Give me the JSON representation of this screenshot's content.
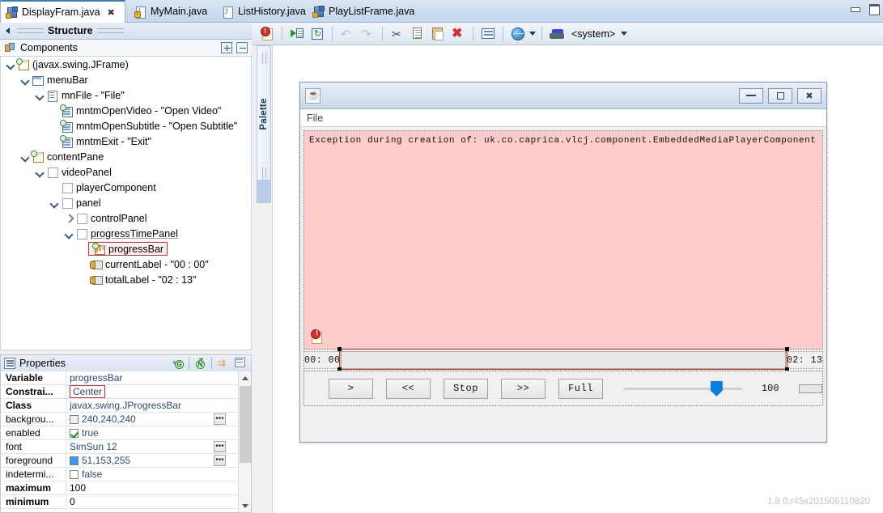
{
  "window": {
    "minimize_label": "minimize",
    "restore_label": "restore"
  },
  "tabs": [
    {
      "label": "DisplayFram.java",
      "icon": "java-class-icon",
      "active": true,
      "close": "✖"
    },
    {
      "label": "MyMain.java",
      "icon": "java-file-icon",
      "active": false
    },
    {
      "label": "ListHistory.java",
      "icon": "java-file-icon",
      "active": false
    },
    {
      "label": "PlayListFrame.java",
      "icon": "java-class-icon",
      "active": false
    }
  ],
  "structure": {
    "title": "Structure"
  },
  "components": {
    "title": "Components",
    "expand_all_label": "+",
    "collapse_all_label": "−",
    "tree": [
      {
        "label": "(javax.swing.JFrame)",
        "indent": 0,
        "twisty": "down",
        "icon": "frame-icon",
        "badge": true
      },
      {
        "label": "menuBar",
        "indent": 1,
        "twisty": "down",
        "icon": "menubar-icon",
        "badge": false
      },
      {
        "label": "mnFile - \"File\"",
        "indent": 2,
        "twisty": "down",
        "icon": "menu-icon",
        "badge": false
      },
      {
        "label": "mntmOpenVideo - \"Open Video\"",
        "indent": 3,
        "twisty": "none",
        "icon": "menuitem-icon",
        "badge": true
      },
      {
        "label": "mntmOpenSubtitle - \"Open Subtitle\"",
        "indent": 3,
        "twisty": "none",
        "icon": "menuitem-icon",
        "badge": true
      },
      {
        "label": "mntmExit - \"Exit\"",
        "indent": 3,
        "twisty": "none",
        "icon": "menuitem-icon",
        "badge": true
      },
      {
        "label": "contentPane",
        "indent": 1,
        "twisty": "down",
        "icon": "frame-icon",
        "badge": true
      },
      {
        "label": "videoPanel",
        "indent": 2,
        "twisty": "down",
        "icon": "panel-icon",
        "badge": false
      },
      {
        "label": "playerComponent",
        "indent": 3,
        "twisty": "none",
        "icon": "panel-icon",
        "badge": false
      },
      {
        "label": "panel",
        "indent": 3,
        "twisty": "down",
        "icon": "panel-icon",
        "badge": false
      },
      {
        "label": "controlPanel",
        "indent": 4,
        "twisty": "right",
        "icon": "panel-icon",
        "badge": false
      },
      {
        "label": "progressTimePanel",
        "indent": 4,
        "twisty": "down",
        "icon": "panel-icon",
        "badge": false,
        "underline": true
      },
      {
        "label": "progressBar",
        "indent": 5,
        "twisty": "none",
        "icon": "progressbar-icon",
        "badge": true,
        "selected": true
      },
      {
        "label": "currentLabel - \"00 : 00\"",
        "indent": 5,
        "twisty": "none",
        "icon": "label-icon",
        "badge": false
      },
      {
        "label": "totalLabel - \"02 : 13\"",
        "indent": 5,
        "twisty": "none",
        "icon": "label-icon",
        "badge": false
      }
    ]
  },
  "properties": {
    "title": "Properties",
    "tools": [
      "goto-definition-icon",
      "show-advanced-icon",
      "restore-default-icon",
      "show-events-icon"
    ],
    "rows": [
      {
        "name": "Variable",
        "value": "progressBar",
        "bold": true,
        "style": "link"
      },
      {
        "name": "Constrai...",
        "value": "Center",
        "bold": true,
        "style": "link",
        "boxed": true
      },
      {
        "name": "Class",
        "value": "javax.swing.JProgressBar",
        "bold": true,
        "style": "link"
      },
      {
        "name": "backgrou...",
        "value": "240,240,240",
        "bold": false,
        "style": "swatch",
        "color": "#f0f0f0",
        "ellipsis": true
      },
      {
        "name": "enabled",
        "value": "true",
        "bold": false,
        "style": "check-on"
      },
      {
        "name": "font",
        "value": "SimSun 12",
        "bold": false,
        "style": "link",
        "ellipsis": true
      },
      {
        "name": "foreground",
        "value": "51,153,255",
        "bold": false,
        "style": "swatch",
        "color": "#3399ff",
        "ellipsis": true
      },
      {
        "name": "indetermi...",
        "value": "false",
        "bold": false,
        "style": "check-off"
      },
      {
        "name": "maximum",
        "value": "100",
        "bold": true,
        "style": "plain"
      },
      {
        "name": "minimum",
        "value": "0",
        "bold": true,
        "style": "plain"
      }
    ]
  },
  "palette": {
    "label": "Palette"
  },
  "toolbar": {
    "items": [
      "error-badge-icon",
      "test-run-icon",
      "refresh-icon",
      "undo-icon",
      "redo-icon",
      "cut-icon",
      "copy-icon",
      "paste-icon",
      "delete-icon",
      "layout-icon",
      "globe-icon",
      "globe-dropdown-icon"
    ],
    "lookandfeel": "<system>",
    "lookandfeel_dropdown": "look-and-feel-dropdown"
  },
  "design": {
    "titlebar_icon": "java-cup-icon",
    "menu": "File",
    "error_text": "Exception during creation of: uk.co.caprica.vlcj.component.EmbeddedMediaPlayerComponent",
    "current_time": "00: 00",
    "total_time": "02: 13",
    "buttons": [
      ">",
      "<<",
      "Stop",
      ">>",
      "Full"
    ],
    "volume_value": "100",
    "slider_percent": 78
  },
  "status": {
    "version": "1.8.0.r45x201506110820"
  }
}
